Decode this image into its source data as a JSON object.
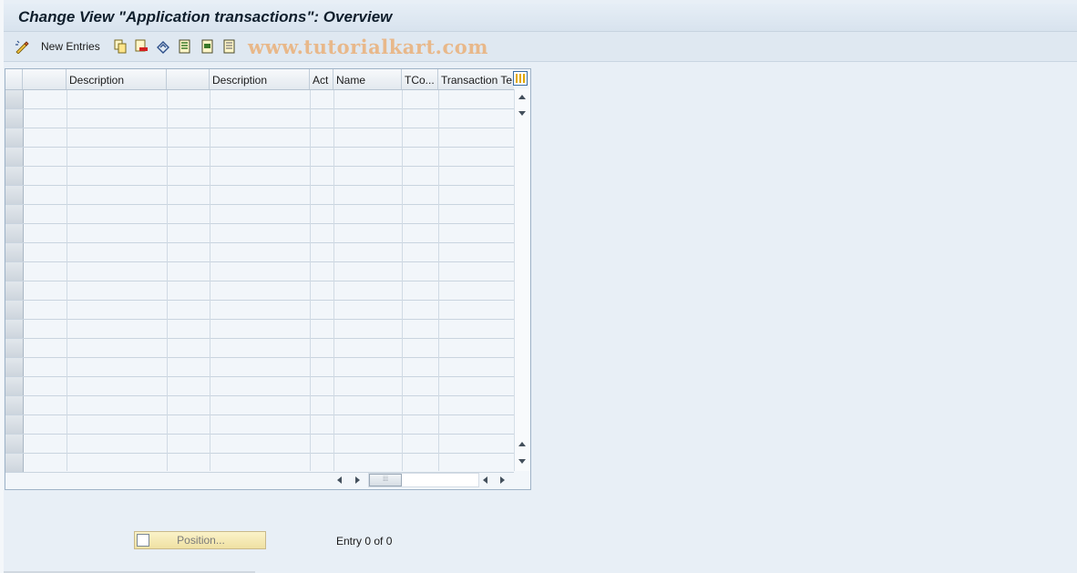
{
  "window": {
    "title": "Change View \"Application transactions\": Overview"
  },
  "toolbar": {
    "new_entries_label": "New Entries",
    "icons": [
      "display-change-icon",
      "copy-icon",
      "delete-icon",
      "undo-icon",
      "select-all-icon",
      "select-block-icon",
      "deselect-all-icon"
    ],
    "watermark": "www.tutorialkart.com"
  },
  "table": {
    "columns": [
      "",
      "Description",
      "",
      "Description",
      "Act",
      "Name",
      "TCo...",
      "Transaction Te"
    ],
    "row_count": 20,
    "rows": []
  },
  "footer": {
    "position_label": "Position...",
    "entry_text": "Entry 0 of 0"
  },
  "colors": {
    "background": "#e8eff6",
    "titlebar": "#dbe5ef",
    "position_button": "#f5eab5",
    "watermark": "#e8b88a"
  }
}
